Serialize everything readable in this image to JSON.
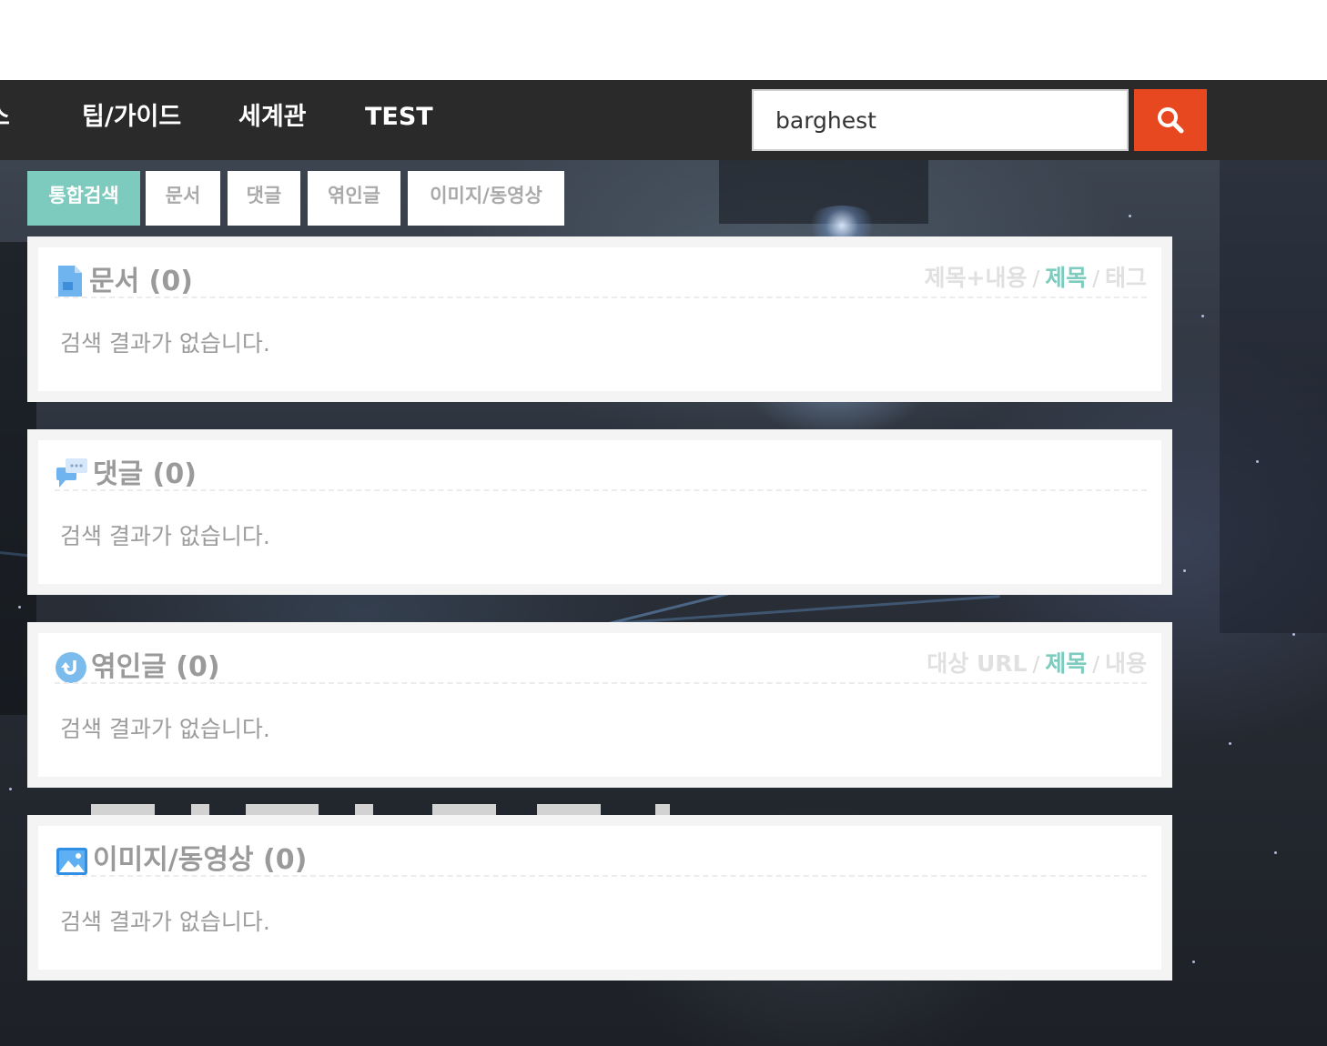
{
  "nav": {
    "items": [
      {
        "label": "스"
      },
      {
        "label": "팁/가이드"
      },
      {
        "label": "세계관"
      },
      {
        "label": "TEST"
      }
    ]
  },
  "search": {
    "value": "barghest",
    "button_icon": "search-icon",
    "button_color": "#e8481f"
  },
  "tabs": [
    {
      "label": "통합검색",
      "active": true
    },
    {
      "label": "문서",
      "active": false
    },
    {
      "label": "댓글",
      "active": false
    },
    {
      "label": "엮인글",
      "active": false
    },
    {
      "label": "이미지/동영상",
      "active": false
    }
  ],
  "sections": {
    "documents": {
      "title": "문서 (0)",
      "icon": "document-icon",
      "empty": "검색 결과가 없습니다.",
      "options": [
        "제목+내용",
        "제목",
        "태그"
      ],
      "active_option": "제목"
    },
    "comments": {
      "title": "댓글 (0)",
      "icon": "comment-icon",
      "empty": "검색 결과가 없습니다."
    },
    "trackbacks": {
      "title": "엮인글 (0)",
      "icon": "trackback-icon",
      "empty": "검색 결과가 없습니다.",
      "options": [
        "대상 URL",
        "제목",
        "내용"
      ],
      "active_option": "제목"
    },
    "media": {
      "title": "이미지/동영상 (0)",
      "icon": "image-icon",
      "empty": "검색 결과가 없습니다."
    }
  },
  "colors": {
    "navbar": "#2a2a2a",
    "accent": "#7ccbbe",
    "search_button": "#e8481f"
  }
}
